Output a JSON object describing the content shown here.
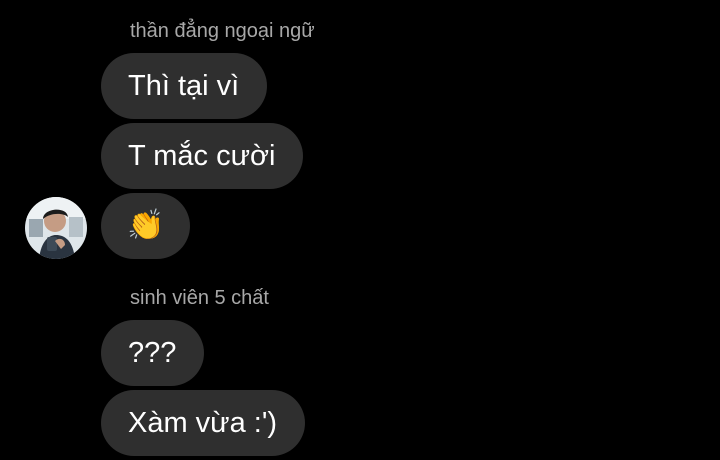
{
  "conversation": {
    "groups": [
      {
        "sender": "thần đẳng ngoại ngữ",
        "messages": [
          "Thì tại vì",
          "T mắc cười",
          "👏"
        ]
      },
      {
        "sender": "sinh viên 5 chất",
        "messages": [
          "???",
          "Xàm vừa :')"
        ]
      }
    ]
  },
  "colors": {
    "background": "#000000",
    "bubble": "#2f2f2f",
    "sender_name": "#a8a8a8",
    "message_text": "#ffffff"
  },
  "icons": {
    "clap": "clapping-hands-emoji"
  }
}
